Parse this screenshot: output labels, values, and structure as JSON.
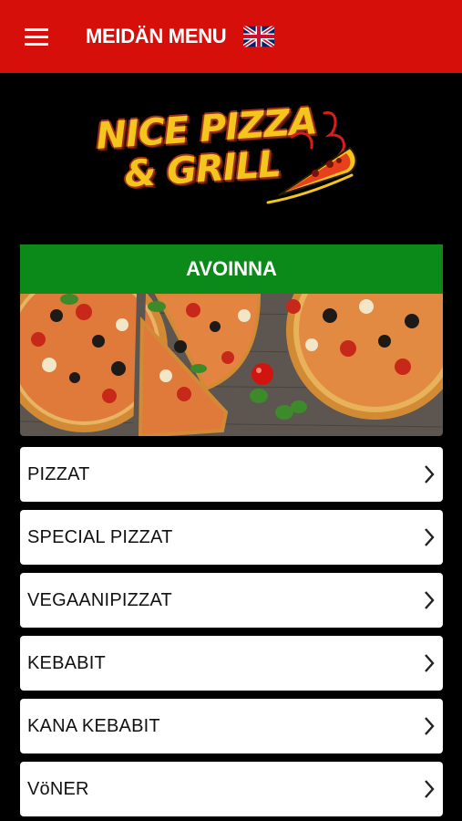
{
  "header": {
    "title": "MEIDÄN MENU",
    "menu_icon": "hamburger-menu-icon",
    "language_icon": "uk-flag-icon",
    "background_color": "#d60f0a"
  },
  "logo": {
    "line1": "NICE PIZZA",
    "line2": "& GRILL",
    "icon": "pizza-slice-icon"
  },
  "status": {
    "label": "AVOINNA",
    "color": "#0b8a19"
  },
  "menu": {
    "items": [
      {
        "label": "PIZZAT"
      },
      {
        "label": "SPECIAL PIZZAT"
      },
      {
        "label": "VEGAANIPIZZAT"
      },
      {
        "label": "KEBABIT"
      },
      {
        "label": "KANA KEBABIT"
      },
      {
        "label": "VöNER"
      }
    ],
    "chevron_icon": "chevron-right-icon"
  }
}
